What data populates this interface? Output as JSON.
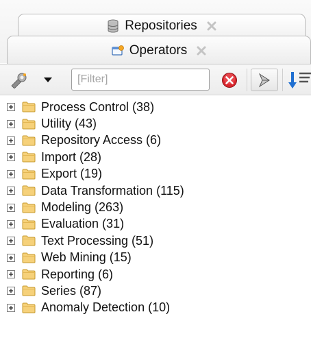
{
  "tabs": [
    {
      "label": "Repositories",
      "icon": "database-icon",
      "active": false
    },
    {
      "label": "Operators",
      "icon": "operators-icon",
      "active": true
    }
  ],
  "toolbar": {
    "filter_placeholder": "[Filter]",
    "filter_value": "",
    "clear_icon": "clear-filter-icon",
    "colors": {
      "clear": "#d9262d",
      "sort": "#1f6fd1",
      "accent": "#f5a623"
    }
  },
  "tree": {
    "items": [
      {
        "label": "Process Control (38)"
      },
      {
        "label": "Utility (43)"
      },
      {
        "label": "Repository Access (6)"
      },
      {
        "label": "Import (28)"
      },
      {
        "label": "Export (19)"
      },
      {
        "label": "Data Transformation (115)"
      },
      {
        "label": "Modeling (263)"
      },
      {
        "label": "Evaluation (31)"
      },
      {
        "label": "Text Processing (51)"
      },
      {
        "label": "Web Mining (15)"
      },
      {
        "label": "Reporting (6)"
      },
      {
        "label": "Series (87)"
      },
      {
        "label": "Anomaly Detection (10)"
      }
    ]
  }
}
